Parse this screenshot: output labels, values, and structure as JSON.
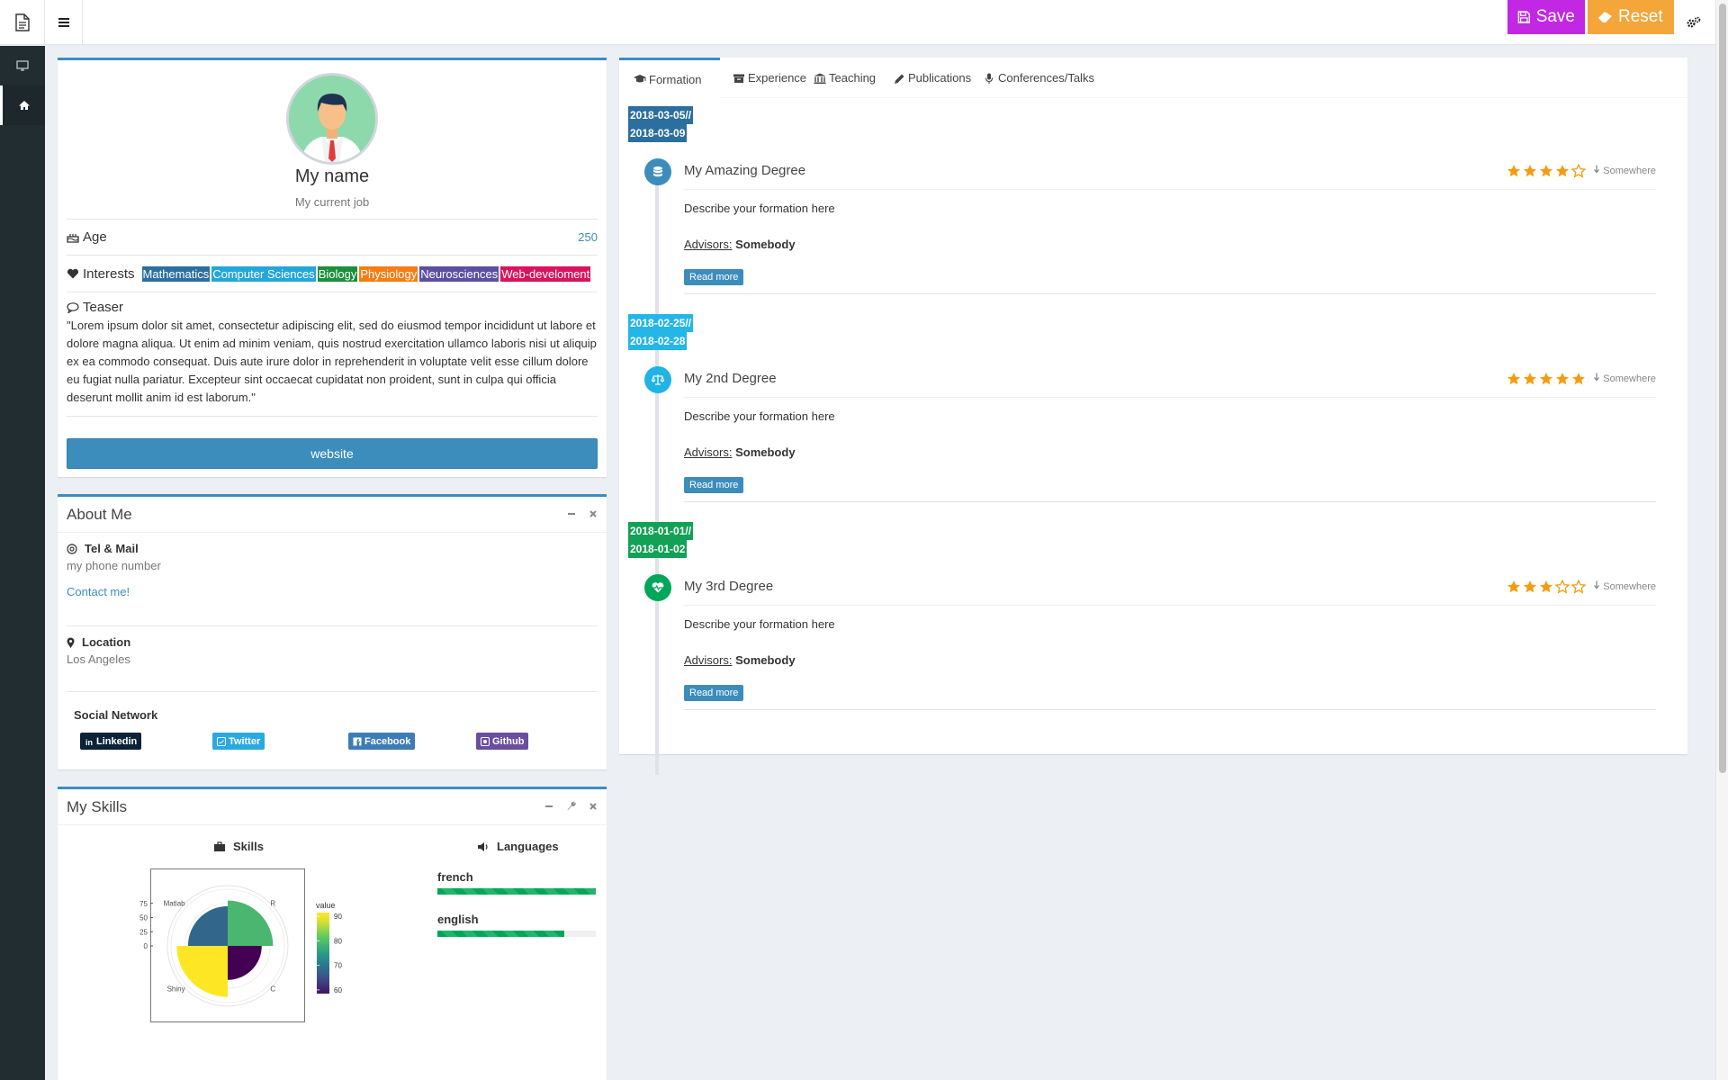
{
  "header": {
    "save_label": "Save",
    "reset_label": "Reset",
    "save_color": "#c228e3",
    "reset_color": "#f5a63a"
  },
  "sidebar": {
    "items": [
      {
        "icon": "desktop-icon"
      },
      {
        "icon": "home-icon",
        "active": true
      }
    ]
  },
  "profile": {
    "name": "My name",
    "job": "My current job",
    "age_label": "Age",
    "age_value": "250",
    "interests_label": "Interests",
    "interests": [
      {
        "label": "Mathematics",
        "color": "#2c6f9f"
      },
      {
        "label": "Computer Sciences",
        "color": "#25a6d9"
      },
      {
        "label": "Biology",
        "color": "#1c8f3c"
      },
      {
        "label": "Physiology",
        "color": "#f57d14"
      },
      {
        "label": "Neurosciences",
        "color": "#5d4fa0"
      },
      {
        "label": "Web-develoment",
        "color": "#d8145e"
      }
    ],
    "teaser_label": "Teaser",
    "teaser_text": "\"Lorem ipsum dolor sit amet, consectetur adipiscing elit, sed do eiusmod tempor incididunt ut labore et dolore magna aliqua. Ut enim ad minim veniam, quis nostrud exercitation ullamco laboris nisi ut aliquip ex ea commodo consequat. Duis aute irure dolor in reprehenderit in voluptate velit esse cillum dolore eu fugiat nulla pariatur. Excepteur sint occaecat cupidatat non proident, sunt in culpa qui officia deserunt mollit anim id est laborum.\"",
    "website_label": "website"
  },
  "about": {
    "title": "About Me",
    "tel_label": "Tel & Mail",
    "tel_value": "my phone number",
    "contact_link": "Contact me!",
    "location_label": "Location",
    "location_value": "Los Angeles",
    "social_label": "Social Network",
    "social": [
      {
        "label": "Linkedin",
        "color": "#0c2237",
        "icon": "linkedin-icon"
      },
      {
        "label": "Twitter",
        "color": "#2aa9e0",
        "icon": "twitter-icon"
      },
      {
        "label": "Facebook",
        "color": "#3d7cb6",
        "icon": "facebook-icon"
      },
      {
        "label": "Github",
        "color": "#6a4f9e",
        "icon": "github-icon"
      }
    ]
  },
  "skills": {
    "title": "My Skills",
    "skills_label": "Skills",
    "languages_label": "Languages",
    "languages": [
      {
        "name": "french",
        "level": 1.0
      },
      {
        "name": "english",
        "level": 0.8
      }
    ]
  },
  "tabs": [
    {
      "label": "Formation",
      "icon": "graduation-cap-icon",
      "active": true
    },
    {
      "label": "Experience",
      "icon": "archive-icon"
    },
    {
      "label": "Teaching",
      "icon": "institution-icon"
    },
    {
      "label": "Publications",
      "icon": "pencil-icon"
    },
    {
      "label": "Conferences/Talks",
      "icon": "microphone-icon"
    }
  ],
  "timeline": [
    {
      "date_start": "2018-03-05//",
      "date_end": "2018-03-09",
      "date_color": "#2c6f9f",
      "icon": "database-icon",
      "icon_color": "#3c8dbc",
      "title": "My Amazing Degree",
      "rating": 4,
      "location": "Somewhere",
      "description": "Describe your formation here",
      "advisors_label": "Advisors:",
      "advisors": "Somebody",
      "read_more": "Read more"
    },
    {
      "date_start": "2018-02-25//",
      "date_end": "2018-02-28",
      "date_color": "#25b6e8",
      "icon": "balance-scale-icon",
      "icon_color": "#1fb3e6",
      "title": "My 2nd Degree",
      "rating": 5,
      "location": "Somewhere",
      "description": "Describe your formation here",
      "advisors_label": "Advisors:",
      "advisors": "Somebody",
      "read_more": "Read more"
    },
    {
      "date_start": "2018-01-01//",
      "date_end": "2018-01-02",
      "date_color": "#12a155",
      "icon": "heartbeat-icon",
      "icon_color": "#00a65a",
      "title": "My 3rd Degree",
      "rating": 3,
      "location": "Somewhere",
      "description": "Describe your formation here",
      "advisors_label": "Advisors:",
      "advisors": "Somebody",
      "read_more": "Read more"
    }
  ],
  "chart_data": {
    "type": "bar",
    "coord": "polar",
    "categories": [
      "R",
      "C",
      "Shiny",
      "Matlab"
    ],
    "values": [
      80,
      60,
      90,
      70
    ],
    "ylim": [
      0,
      100
    ],
    "yticks": [
      "0",
      "25",
      "50",
      "75"
    ],
    "legend_title": "value",
    "legend_ticks": [
      "90",
      "80",
      "70",
      "60"
    ],
    "legend_placement": "right",
    "colormap": "viridis"
  }
}
